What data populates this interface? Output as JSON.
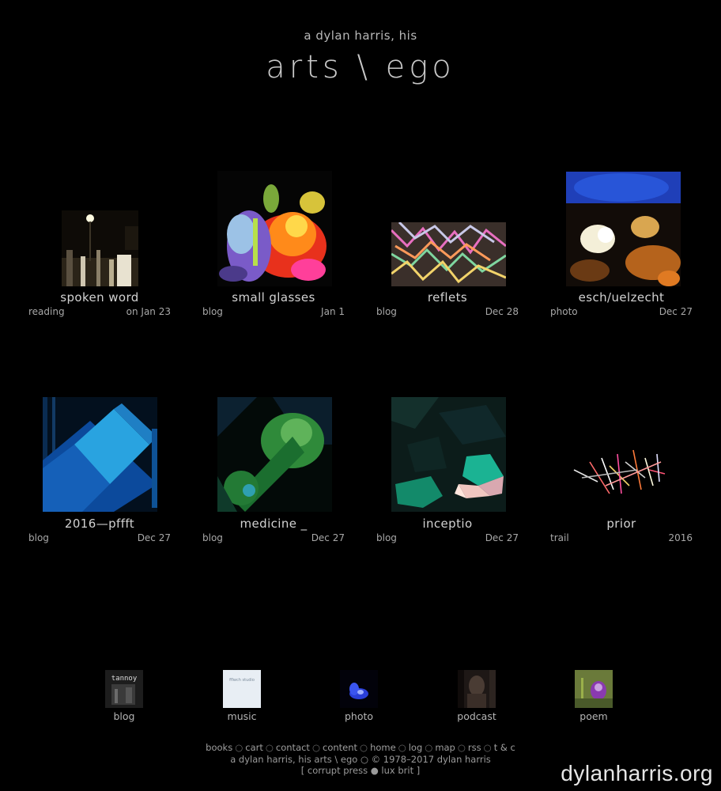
{
  "header": {
    "subtitle": "a dylan harris, his",
    "title": "arts \\ ego"
  },
  "tiles": [
    {
      "name": "spoken word",
      "category": "reading",
      "date": "on Jan 23"
    },
    {
      "name": "small glasses",
      "category": "blog",
      "date": "Jan 1"
    },
    {
      "name": "reflets",
      "category": "blog",
      "date": "Dec 28"
    },
    {
      "name": "esch/uelzecht",
      "category": "photo",
      "date": "Dec 27"
    },
    {
      "name": "2016—pffft",
      "category": "blog",
      "date": "Dec 27"
    },
    {
      "name": "medicine _",
      "category": "blog",
      "date": "Dec 27"
    },
    {
      "name": "inceptio",
      "category": "blog",
      "date": "Dec 27"
    },
    {
      "name": "prior",
      "category": "trail",
      "date": "2016"
    }
  ],
  "sections": [
    {
      "label": "blog",
      "thumb_text": "tannoy"
    },
    {
      "label": "music",
      "thumb_text": "fflwch studio"
    },
    {
      "label": "photo"
    },
    {
      "label": "podcast"
    },
    {
      "label": "poem"
    }
  ],
  "footer": {
    "links": [
      "books",
      "cart",
      "contact",
      "content",
      "home",
      "log",
      "map",
      "rss",
      "t & c"
    ],
    "separator": "○",
    "copyright": "a dylan harris, his arts \\ ego ○ © 1978–2017 dylan harris",
    "press": "[ corrupt press ● lux brit ]"
  },
  "watermark": "dylanharris.org"
}
